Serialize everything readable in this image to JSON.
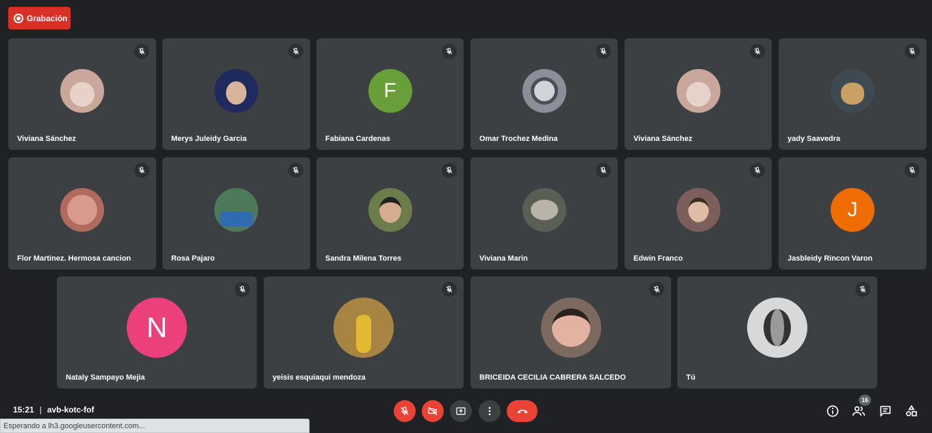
{
  "recording": {
    "label": "Grabación"
  },
  "participants": [
    {
      "name": "Viviana Sánchez",
      "avatar": "photo-woman",
      "color": "#c9a79a"
    },
    {
      "name": "Merys Juleidy Garcia",
      "avatar": "photo-woman-dark-hair",
      "color": "#1f2b5e"
    },
    {
      "name": "Fabiana Cardenas",
      "avatar": "F",
      "color": "#689f38"
    },
    {
      "name": "Omar Trochez Medina",
      "avatar": "photo-helmet",
      "color": "#8a8f99"
    },
    {
      "name": "Viviana Sánchez",
      "avatar": "photo-woman",
      "color": "#c9a79a"
    },
    {
      "name": "yady Saavedra",
      "avatar": "photo-dog",
      "color": "#7a6a4e"
    },
    {
      "name": "Flor Martinez. Hermosa cancion",
      "avatar": "photo-face-closeup",
      "color": "#b06a5e"
    },
    {
      "name": "Rosa Pajaro",
      "avatar": "photo-family",
      "color": "#4f7a5a"
    },
    {
      "name": "Sandra Milena Torres",
      "avatar": "photo-woman-sunglasses",
      "color": "#6b7d4a"
    },
    {
      "name": "Viviana Marin",
      "avatar": "photo-monkey",
      "color": "#5a5e54"
    },
    {
      "name": "Edwin Franco",
      "avatar": "photo-man",
      "color": "#7c5f5a"
    },
    {
      "name": "Jasbleidy Rincon Varon",
      "avatar": "J",
      "color": "#ef6c00"
    },
    {
      "name": "Nataly Sampayo Mejia",
      "avatar": "N",
      "color": "#ec407a"
    },
    {
      "name": "yeisis esquiaqui mendoza",
      "avatar": "photo-woman-wings",
      "color": "#a88442"
    },
    {
      "name": "BRICEIDA CECILIA CABRERA SALCEDO",
      "avatar": "photo-woman-smiling",
      "color": "#7d6a5e"
    },
    {
      "name": "Tú",
      "avatar": "photo-woman-bw",
      "color": "#d8d8d8"
    }
  ],
  "meeting": {
    "time": "15:21",
    "separator": "|",
    "code": "avb-kotc-fof"
  },
  "people_count": "16",
  "status_bar": "Esperando a lh3.googleusercontent.com...",
  "colors": {
    "background": "#202124",
    "tile": "#3c4043",
    "danger": "#ea4335",
    "record": "#d93025"
  }
}
